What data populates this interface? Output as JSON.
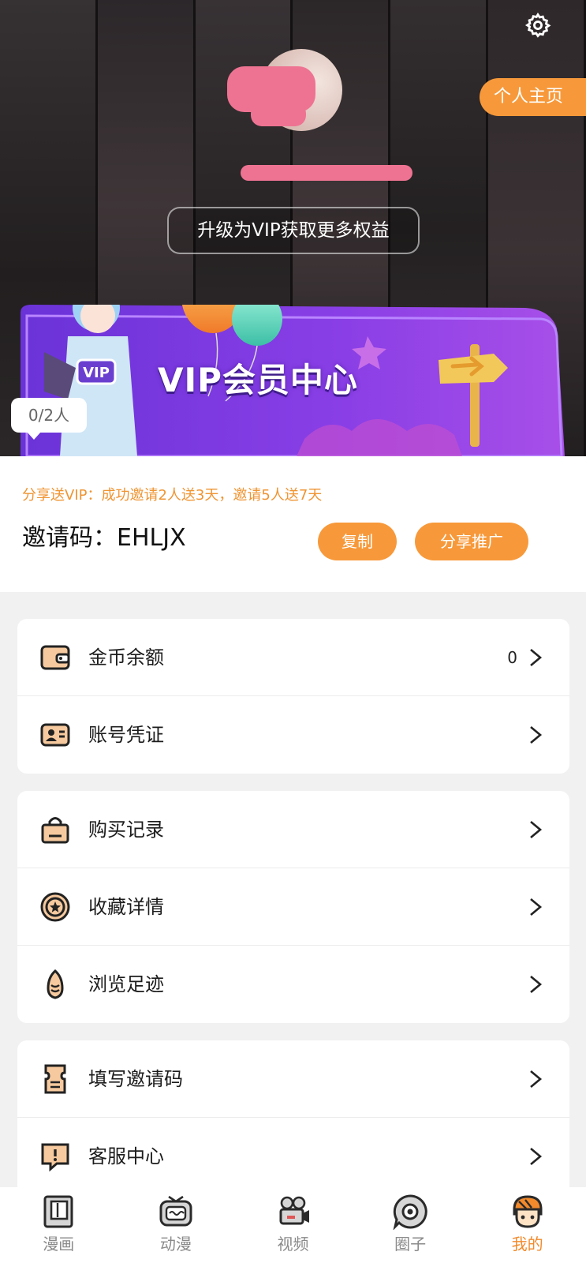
{
  "header": {
    "settings_icon": "gear-icon",
    "profile_button": "个人主页",
    "nickname": "",
    "upgrade_button": "升级为VIP获取更多权益"
  },
  "vip_banner": {
    "title": "VIP会员中心",
    "badge": "VIP",
    "invite_progress": "0/2人"
  },
  "invite": {
    "tip": "分享送VIP：成功邀请2人送3天，邀请5人送7天",
    "code_label": "邀请码：EHLJX",
    "copy_button": "复制",
    "share_button": "分享推广"
  },
  "menu": {
    "group1": [
      {
        "label": "金币余额",
        "value": "0",
        "icon": "wallet-icon"
      },
      {
        "label": "账号凭证",
        "value": "",
        "icon": "id-card-icon"
      }
    ],
    "group2": [
      {
        "label": "购买记录",
        "icon": "shopping-bag-icon"
      },
      {
        "label": "收藏详情",
        "icon": "star-badge-icon"
      },
      {
        "label": "浏览足迹",
        "icon": "footprint-icon"
      }
    ],
    "group3": [
      {
        "label": "填写邀请码",
        "icon": "ticket-icon"
      },
      {
        "label": "客服中心",
        "icon": "support-icon"
      }
    ]
  },
  "tabbar": [
    {
      "label": "漫画",
      "icon": "book-icon",
      "active": false
    },
    {
      "label": "动漫",
      "icon": "tv-icon",
      "active": false
    },
    {
      "label": "视频",
      "icon": "camera-icon",
      "active": false
    },
    {
      "label": "圈子",
      "icon": "chat-circle-icon",
      "active": false
    },
    {
      "label": "我的",
      "icon": "profile-face-icon",
      "active": true
    }
  ],
  "colors": {
    "accent": "#f7993a",
    "tip_text": "#ef9432",
    "active_tab": "#f28a2c",
    "redaction": "#ee7392",
    "vip_purple": "#7b3fe4"
  }
}
